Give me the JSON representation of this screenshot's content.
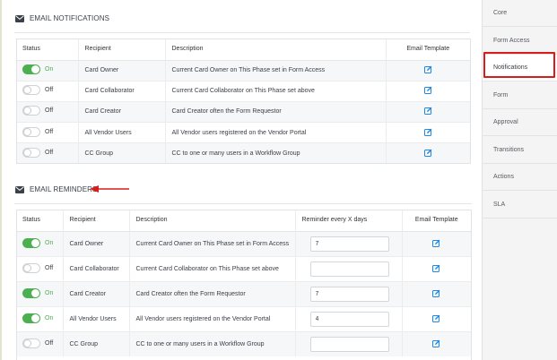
{
  "notifications": {
    "title": "EMAIL NOTIFICATIONS",
    "headers": {
      "status": "Status",
      "recipient": "Recipient",
      "description": "Description",
      "template": "Email Template"
    },
    "rows": [
      {
        "state": "On",
        "recipient": "Card Owner",
        "description": "Current Card Owner on This Phase set in Form Access"
      },
      {
        "state": "Off",
        "recipient": "Card Collaborator",
        "description": "Current Card Collaborator on This Phase set above"
      },
      {
        "state": "Off",
        "recipient": "Card Creator",
        "description": "Card Creator often the Form Requestor"
      },
      {
        "state": "Off",
        "recipient": "All Vendor Users",
        "description": "All Vendor users registered on the Vendor Portal"
      },
      {
        "state": "Off",
        "recipient": "CC Group",
        "description": "CC to one or many users in a Workflow Group"
      }
    ]
  },
  "reminders": {
    "title": "EMAIL REMINDERS",
    "headers": {
      "status": "Status",
      "recipient": "Recipient",
      "description": "Description",
      "days": "Reminder every X days",
      "template": "Email Template"
    },
    "rows": [
      {
        "state": "On",
        "recipient": "Card Owner",
        "description": "Current Card Owner on This Phase set in Form Access",
        "days": "7"
      },
      {
        "state": "Off",
        "recipient": "Card Collaborator",
        "description": "Current Card Collaborator on This Phase set above",
        "days": ""
      },
      {
        "state": "On",
        "recipient": "Card Creator",
        "description": "Card Creator often the Form Requestor",
        "days": "7"
      },
      {
        "state": "On",
        "recipient": "All Vendor Users",
        "description": "All Vendor users registered on the Vendor Portal",
        "days": "4"
      },
      {
        "state": "Off",
        "recipient": "CC Group",
        "description": "CC to one or many users in a Workflow Group",
        "days": ""
      }
    ]
  },
  "sidebar": {
    "items": [
      {
        "label": "Core"
      },
      {
        "label": "Form Access"
      },
      {
        "label": "Notifications"
      },
      {
        "label": "Form"
      },
      {
        "label": "Approval"
      },
      {
        "label": "Transitions"
      },
      {
        "label": "Actions"
      },
      {
        "label": "SLA"
      }
    ],
    "active_index": 2
  },
  "colors": {
    "toggle_on": "#4caf50",
    "edit_icon": "#1e88e5",
    "annotation": "#d81c1c"
  }
}
